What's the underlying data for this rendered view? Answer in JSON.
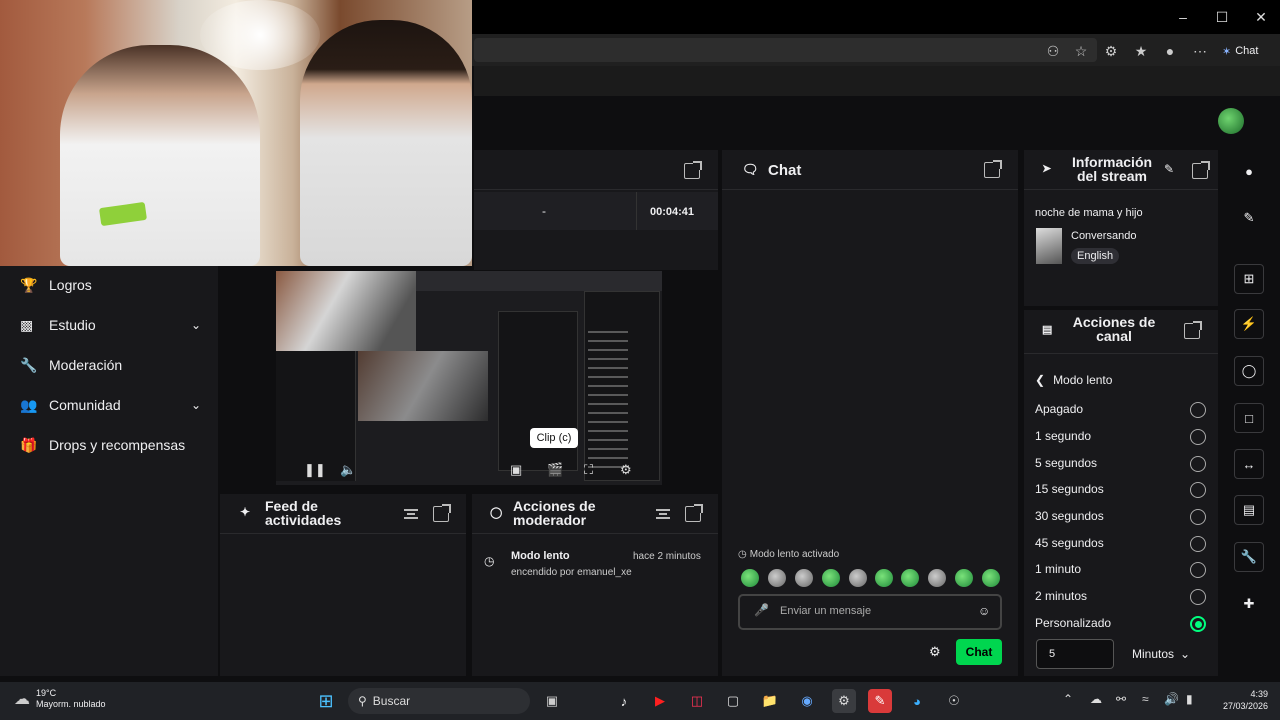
{
  "browser": {
    "chat_button": "Chat",
    "colors": {
      "chrome": "#000000",
      "address": "#202020"
    }
  },
  "stats": {
    "dash": "-",
    "time": "00:04:41"
  },
  "sidebar": {
    "items": [
      {
        "label": "Logros",
        "icon": "trophy-icon"
      },
      {
        "label": "Estudio",
        "icon": "video-icon",
        "expand": true
      },
      {
        "label": "Moderación",
        "icon": "wrench-icon"
      },
      {
        "label": "Comunidad",
        "icon": "people-icon",
        "expand": true
      },
      {
        "label": "Drops y recompensas",
        "icon": "gift-icon"
      }
    ]
  },
  "video": {
    "clip_tooltip": "Clip (c)"
  },
  "feed": {
    "title": "Feed de actividades"
  },
  "mod_actions": {
    "title": "Acciones de moderador",
    "entry_title": "Modo lento",
    "entry_time": "hace 2 minutos",
    "entry_sub": "encendido por emanuel_xe"
  },
  "chat": {
    "title": "Chat",
    "slow_mode_notice": "Modo lento activado",
    "input_placeholder": "Enviar un mensaje",
    "send_label": "Chat",
    "accent": "#00d64f"
  },
  "stream_info": {
    "title": "Información del stream",
    "stream_title": "noche de mama y hijo",
    "category": "Conversando",
    "tag": "English"
  },
  "channel_actions": {
    "title": "Acciones de canal",
    "back_label": "Modo lento",
    "options": [
      {
        "label": "Apagado",
        "selected": false
      },
      {
        "label": "1 segundo",
        "selected": false
      },
      {
        "label": "5 segundos",
        "selected": false
      },
      {
        "label": "15 segundos",
        "selected": false
      },
      {
        "label": "30 segundos",
        "selected": false
      },
      {
        "label": "45 segundos",
        "selected": false
      },
      {
        "label": "1 minuto",
        "selected": false
      },
      {
        "label": "2 minutos",
        "selected": false
      },
      {
        "label": "Personalizado",
        "selected": true
      }
    ],
    "custom_value": "5",
    "unit_label": "Minutos"
  },
  "taskbar": {
    "weather_temp": "19°C",
    "weather_text": "Mayorm. nublado",
    "search_placeholder": "Buscar",
    "time": "4:39",
    "date": "27/03/2026"
  }
}
